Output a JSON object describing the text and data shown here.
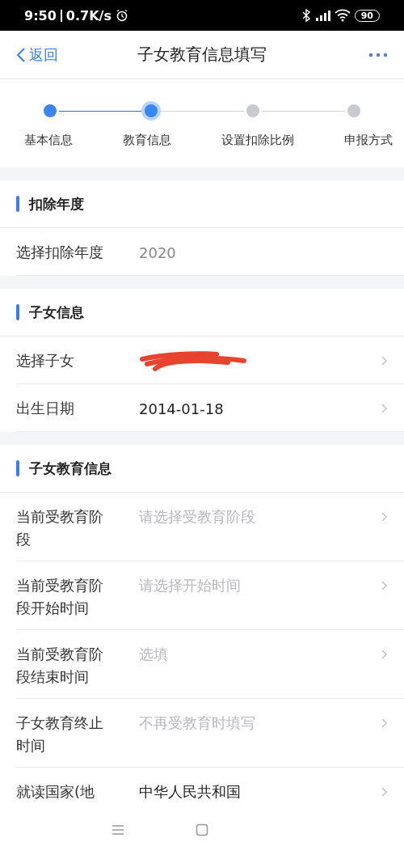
{
  "status_bar": {
    "time": "9:50",
    "speed": "0.7K/s",
    "battery": "90"
  },
  "header": {
    "back": "返回",
    "title": "子女教育信息填写"
  },
  "steps": [
    {
      "label": "基本信息",
      "done": true,
      "selected": false
    },
    {
      "label": "教育信息",
      "done": true,
      "selected": true
    },
    {
      "label": "设置扣除比例",
      "done": false,
      "selected": false
    },
    {
      "label": "申报方式",
      "done": false,
      "selected": false
    }
  ],
  "sections": [
    {
      "title": "扣除年度",
      "rows": [
        {
          "label": "选择扣除年度",
          "value": "2020",
          "kind": "value",
          "arrow": false
        }
      ]
    },
    {
      "title": "子女信息",
      "rows": [
        {
          "label": "选择子女",
          "kind": "redacted",
          "arrow": true
        },
        {
          "label": "出生日期",
          "value": "2014-01-18",
          "kind": "value",
          "arrow": true
        }
      ]
    },
    {
      "title": "子女教育信息",
      "rows": [
        {
          "label": "当前受教育阶段",
          "placeholder": "请选择受教育阶段",
          "kind": "select",
          "arrow": true
        },
        {
          "label": "当前受教育阶段开始时间",
          "placeholder": "请选择开始时间",
          "kind": "select",
          "arrow": true
        },
        {
          "label": "当前受教育阶段结束时间",
          "placeholder": "选填",
          "kind": "select",
          "arrow": true
        },
        {
          "label": "子女教育终止时间",
          "placeholder": "不再受教育时填写",
          "kind": "select",
          "arrow": true
        },
        {
          "label": "就读国家(地",
          "value": "中华人民共和国",
          "kind": "value",
          "arrow": true
        }
      ]
    }
  ]
}
